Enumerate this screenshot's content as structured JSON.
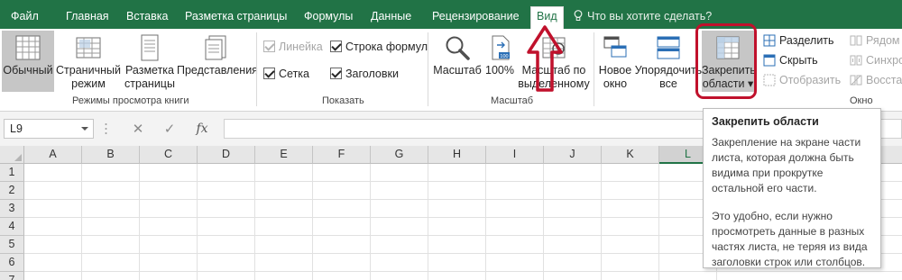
{
  "tabs": [
    {
      "label": "Файл",
      "active": false
    },
    {
      "label": "Главная",
      "active": false
    },
    {
      "label": "Вставка",
      "active": false
    },
    {
      "label": "Разметка страницы",
      "active": false
    },
    {
      "label": "Формулы",
      "active": false
    },
    {
      "label": "Данные",
      "active": false
    },
    {
      "label": "Рецензирование",
      "active": false
    },
    {
      "label": "Вид",
      "active": true
    }
  ],
  "tellme": "Что вы хотите сделать?",
  "groups": {
    "views": {
      "label": "Режимы просмотра книги",
      "normal": "Обычный",
      "page_break": [
        "Страничный",
        "режим"
      ],
      "page_layout": [
        "Разметка",
        "страницы"
      ],
      "custom_views": "Представления"
    },
    "show": {
      "label": "Показать",
      "ruler": "Линейка",
      "formula_bar": "Строка формул",
      "gridlines": "Сетка",
      "headings": "Заголовки"
    },
    "zoom": {
      "label": "Масштаб",
      "zoom": "Масштаб",
      "hundred": "100%",
      "zoom_selection": [
        "Масштаб по",
        "выделенному"
      ]
    },
    "window": {
      "label": "Окно",
      "new_window": [
        "Новое",
        "окно"
      ],
      "arrange_all": [
        "Упорядочить",
        "все"
      ],
      "freeze_panes": [
        "Закрепить",
        "области ▾"
      ],
      "split": "Разделить",
      "hide": "Скрыть",
      "unhide": "Отобразить",
      "side_by_side": "Рядом",
      "sync_scroll": "Синхро",
      "reset_position": "Восстан"
    }
  },
  "formula_bar": {
    "name_box": "L9",
    "fx": "fx"
  },
  "columns": [
    "A",
    "B",
    "C",
    "D",
    "E",
    "F",
    "G",
    "H",
    "I",
    "J",
    "K",
    "L"
  ],
  "active_column": "L",
  "rows": [
    "1",
    "2",
    "3",
    "4",
    "5",
    "6",
    "7"
  ],
  "tooltip": {
    "title": "Закрепить области",
    "para1": "Закрепление на экране части листа, которая должна быть видима при прокрутке остальной его части.",
    "para2": "Это удобно, если нужно просмотреть данные в разных частях листа, не теряя из вида заголовки строк или столбцов."
  },
  "colors": {
    "accent": "#217346",
    "annotation": "#c0112c"
  }
}
